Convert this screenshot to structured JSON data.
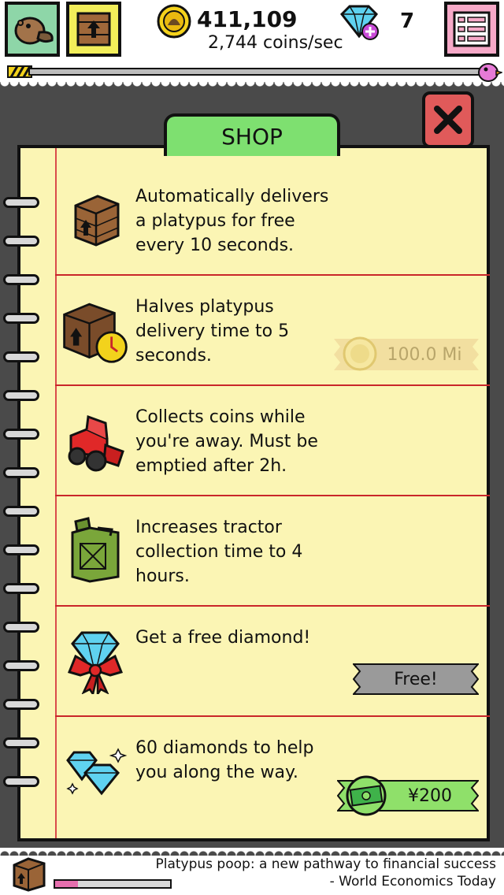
{
  "header": {
    "coins_total": "411,109",
    "coins_rate": "2,744 coins/sec",
    "diamonds": "7",
    "buttons": [
      "platypus-button",
      "crate-button",
      "menu-button"
    ]
  },
  "progress": {
    "level_fraction": 0.02
  },
  "shop": {
    "title": "SHOP",
    "close_label": "X",
    "items": [
      {
        "id": "auto-delivery",
        "description": "Automatically delivers\na platypus for free\nevery 10 seconds.",
        "icon": "crate-icon"
      },
      {
        "id": "halve-delivery",
        "description": "Halves platypus\ndelivery time to 5\nseconds.",
        "icon": "crate-clock-icon",
        "price": "100.0 Mi",
        "price_state": "locked"
      },
      {
        "id": "tractor",
        "description": "Collects coins while\nyou're away. Must be\nemptied after 2h.",
        "icon": "tractor-icon"
      },
      {
        "id": "jerrycan",
        "description": "Increases tractor\ncollection time to 4\nhours.",
        "icon": "jerrycan-icon"
      },
      {
        "id": "free-diamond",
        "description": "Get a free diamond!",
        "icon": "gift-diamond-icon",
        "price": "Free!",
        "price_state": "free"
      },
      {
        "id": "diamond-pack",
        "description": "60 diamonds to help\nyou along the way.",
        "icon": "diamonds-icon",
        "price": "¥200",
        "price_state": "money"
      }
    ]
  },
  "footer": {
    "quote_line1": "Platypus poop: a new pathway to financial success",
    "quote_line2": "- World Economics Today",
    "crate_progress": 0.2
  },
  "colors": {
    "board": "#4a4a4a",
    "paper": "#fbf5b4",
    "tab_green": "#7ee070",
    "close_red": "#e05a5a",
    "rule_red": "#c9262a",
    "free_grey": "#9a9a9a",
    "money_green": "#8fe06a",
    "locked_tan": "#f2dfa0"
  }
}
